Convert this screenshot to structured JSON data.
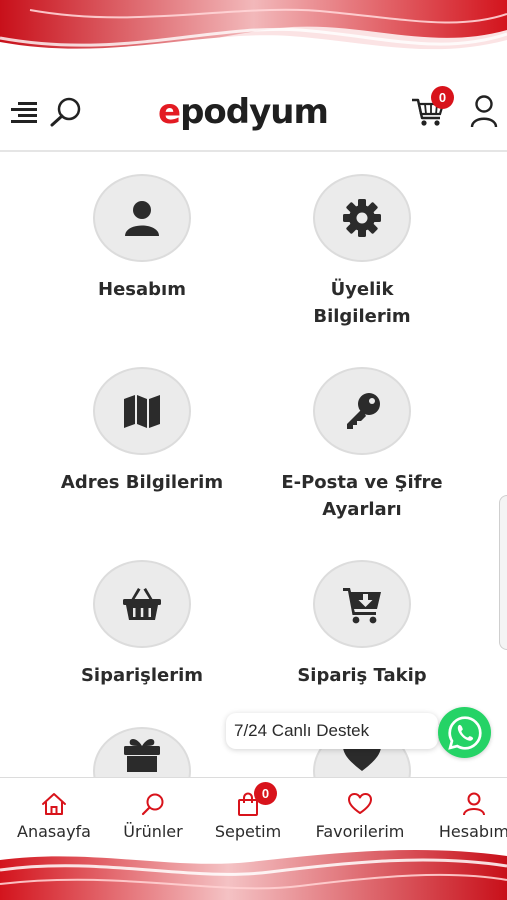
{
  "brand": {
    "logo_e": "e",
    "logo_rest": "podyum",
    "accent": "#e31b23"
  },
  "header": {
    "cart_count": "0"
  },
  "menu": [
    {
      "label": "Hesabım",
      "icon": "user-icon"
    },
    {
      "label": "Üyelik Bilgilerim",
      "icon": "gear-icon"
    },
    {
      "label": "Adres Bilgilerim",
      "icon": "map-icon"
    },
    {
      "label": "E-Posta ve Şifre Ayarları",
      "icon": "key-icon"
    },
    {
      "label": "Siparişlerim",
      "icon": "basket-icon"
    },
    {
      "label": "Sipariş Takip",
      "icon": "cart-download-icon"
    },
    {
      "label": "",
      "icon": "gift-icon"
    },
    {
      "label": "",
      "icon": "heart-icon"
    }
  ],
  "support": {
    "label": "7/24 Canlı Destek",
    "icon": "whatsapp-icon",
    "color": "#25d366"
  },
  "bottom_nav": [
    {
      "label": "Anasayfa",
      "icon": "home-icon"
    },
    {
      "label": "Ürünler",
      "icon": "search-icon"
    },
    {
      "label": "Sepetim",
      "icon": "bag-icon",
      "badge": "0"
    },
    {
      "label": "Favorilerim",
      "icon": "heart-icon"
    },
    {
      "label": "Hesabım",
      "icon": "user-icon"
    }
  ]
}
